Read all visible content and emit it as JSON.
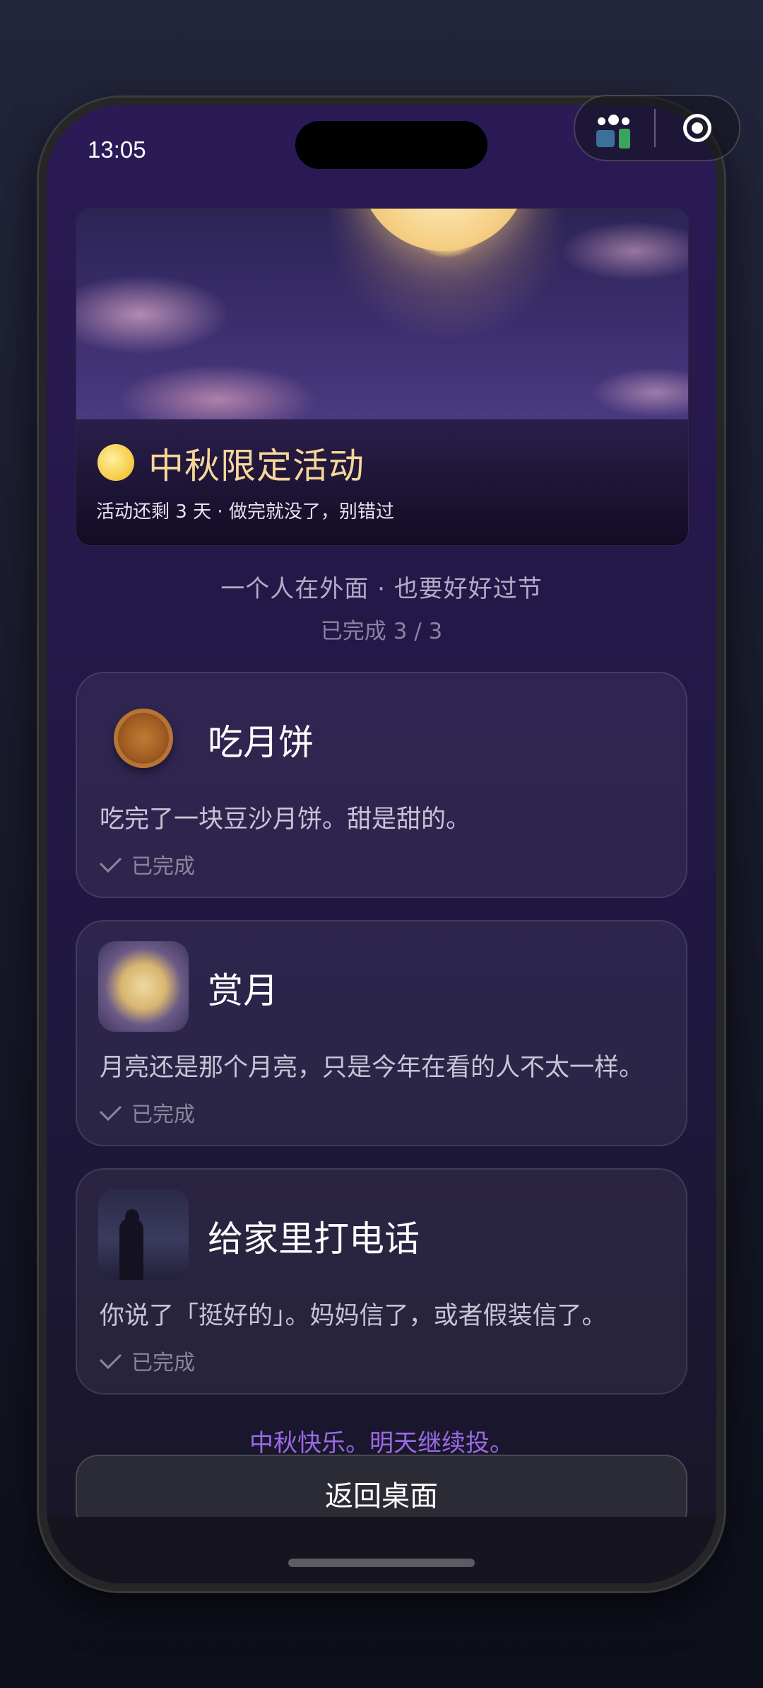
{
  "status": {
    "time": "13:05"
  },
  "banner": {
    "title": "中秋限定活动",
    "subtitle": "活动还剩 3 天 · 做完就没了，别错过"
  },
  "header": {
    "tagline": "一个人在外面 · 也要好好过节",
    "progress": "已完成 3 / 3"
  },
  "tasks": [
    {
      "icon": "mooncake-icon",
      "title": "吃月饼",
      "desc": "吃完了一块豆沙月饼。甜是甜的。",
      "status": "已完成"
    },
    {
      "icon": "moon-icon",
      "title": "赏月",
      "desc": "月亮还是那个月亮，只是今年在看的人不太一样。",
      "status": "已完成"
    },
    {
      "icon": "person-icon",
      "title": "给家里打电话",
      "desc": "你说了「挺好的」。妈妈信了，或者假装信了。",
      "status": "已完成"
    }
  ],
  "footer": {
    "note": "中秋快乐。明天继续投。",
    "back_label": "返回桌面"
  },
  "colors": {
    "accent": "#9a6ae6",
    "banner_title": "#f6d79a"
  }
}
